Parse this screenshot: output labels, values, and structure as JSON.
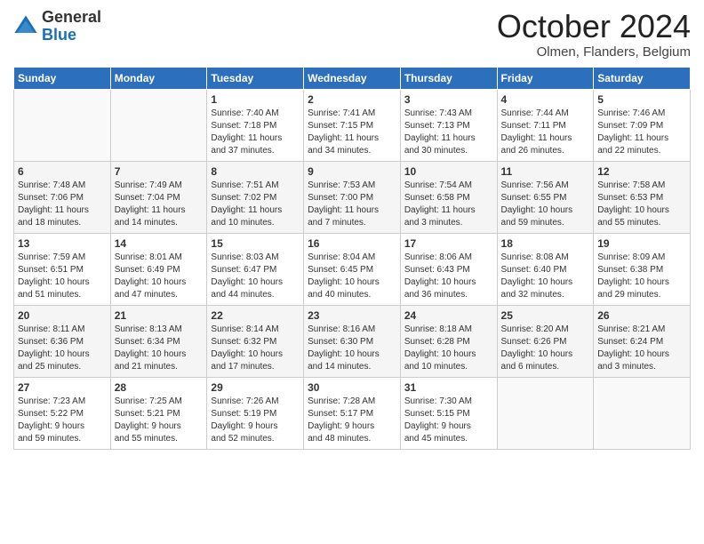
{
  "logo": {
    "general": "General",
    "blue": "Blue"
  },
  "title": "October 2024",
  "location": "Olmen, Flanders, Belgium",
  "days_of_week": [
    "Sunday",
    "Monday",
    "Tuesday",
    "Wednesday",
    "Thursday",
    "Friday",
    "Saturday"
  ],
  "weeks": [
    [
      {
        "day": "",
        "info": ""
      },
      {
        "day": "",
        "info": ""
      },
      {
        "day": "1",
        "info": "Sunrise: 7:40 AM\nSunset: 7:18 PM\nDaylight: 11 hours\nand 37 minutes."
      },
      {
        "day": "2",
        "info": "Sunrise: 7:41 AM\nSunset: 7:15 PM\nDaylight: 11 hours\nand 34 minutes."
      },
      {
        "day": "3",
        "info": "Sunrise: 7:43 AM\nSunset: 7:13 PM\nDaylight: 11 hours\nand 30 minutes."
      },
      {
        "day": "4",
        "info": "Sunrise: 7:44 AM\nSunset: 7:11 PM\nDaylight: 11 hours\nand 26 minutes."
      },
      {
        "day": "5",
        "info": "Sunrise: 7:46 AM\nSunset: 7:09 PM\nDaylight: 11 hours\nand 22 minutes."
      }
    ],
    [
      {
        "day": "6",
        "info": "Sunrise: 7:48 AM\nSunset: 7:06 PM\nDaylight: 11 hours\nand 18 minutes."
      },
      {
        "day": "7",
        "info": "Sunrise: 7:49 AM\nSunset: 7:04 PM\nDaylight: 11 hours\nand 14 minutes."
      },
      {
        "day": "8",
        "info": "Sunrise: 7:51 AM\nSunset: 7:02 PM\nDaylight: 11 hours\nand 10 minutes."
      },
      {
        "day": "9",
        "info": "Sunrise: 7:53 AM\nSunset: 7:00 PM\nDaylight: 11 hours\nand 7 minutes."
      },
      {
        "day": "10",
        "info": "Sunrise: 7:54 AM\nSunset: 6:58 PM\nDaylight: 11 hours\nand 3 minutes."
      },
      {
        "day": "11",
        "info": "Sunrise: 7:56 AM\nSunset: 6:55 PM\nDaylight: 10 hours\nand 59 minutes."
      },
      {
        "day": "12",
        "info": "Sunrise: 7:58 AM\nSunset: 6:53 PM\nDaylight: 10 hours\nand 55 minutes."
      }
    ],
    [
      {
        "day": "13",
        "info": "Sunrise: 7:59 AM\nSunset: 6:51 PM\nDaylight: 10 hours\nand 51 minutes."
      },
      {
        "day": "14",
        "info": "Sunrise: 8:01 AM\nSunset: 6:49 PM\nDaylight: 10 hours\nand 47 minutes."
      },
      {
        "day": "15",
        "info": "Sunrise: 8:03 AM\nSunset: 6:47 PM\nDaylight: 10 hours\nand 44 minutes."
      },
      {
        "day": "16",
        "info": "Sunrise: 8:04 AM\nSunset: 6:45 PM\nDaylight: 10 hours\nand 40 minutes."
      },
      {
        "day": "17",
        "info": "Sunrise: 8:06 AM\nSunset: 6:43 PM\nDaylight: 10 hours\nand 36 minutes."
      },
      {
        "day": "18",
        "info": "Sunrise: 8:08 AM\nSunset: 6:40 PM\nDaylight: 10 hours\nand 32 minutes."
      },
      {
        "day": "19",
        "info": "Sunrise: 8:09 AM\nSunset: 6:38 PM\nDaylight: 10 hours\nand 29 minutes."
      }
    ],
    [
      {
        "day": "20",
        "info": "Sunrise: 8:11 AM\nSunset: 6:36 PM\nDaylight: 10 hours\nand 25 minutes."
      },
      {
        "day": "21",
        "info": "Sunrise: 8:13 AM\nSunset: 6:34 PM\nDaylight: 10 hours\nand 21 minutes."
      },
      {
        "day": "22",
        "info": "Sunrise: 8:14 AM\nSunset: 6:32 PM\nDaylight: 10 hours\nand 17 minutes."
      },
      {
        "day": "23",
        "info": "Sunrise: 8:16 AM\nSunset: 6:30 PM\nDaylight: 10 hours\nand 14 minutes."
      },
      {
        "day": "24",
        "info": "Sunrise: 8:18 AM\nSunset: 6:28 PM\nDaylight: 10 hours\nand 10 minutes."
      },
      {
        "day": "25",
        "info": "Sunrise: 8:20 AM\nSunset: 6:26 PM\nDaylight: 10 hours\nand 6 minutes."
      },
      {
        "day": "26",
        "info": "Sunrise: 8:21 AM\nSunset: 6:24 PM\nDaylight: 10 hours\nand 3 minutes."
      }
    ],
    [
      {
        "day": "27",
        "info": "Sunrise: 7:23 AM\nSunset: 5:22 PM\nDaylight: 9 hours\nand 59 minutes."
      },
      {
        "day": "28",
        "info": "Sunrise: 7:25 AM\nSunset: 5:21 PM\nDaylight: 9 hours\nand 55 minutes."
      },
      {
        "day": "29",
        "info": "Sunrise: 7:26 AM\nSunset: 5:19 PM\nDaylight: 9 hours\nand 52 minutes."
      },
      {
        "day": "30",
        "info": "Sunrise: 7:28 AM\nSunset: 5:17 PM\nDaylight: 9 hours\nand 48 minutes."
      },
      {
        "day": "31",
        "info": "Sunrise: 7:30 AM\nSunset: 5:15 PM\nDaylight: 9 hours\nand 45 minutes."
      },
      {
        "day": "",
        "info": ""
      },
      {
        "day": "",
        "info": ""
      }
    ]
  ]
}
